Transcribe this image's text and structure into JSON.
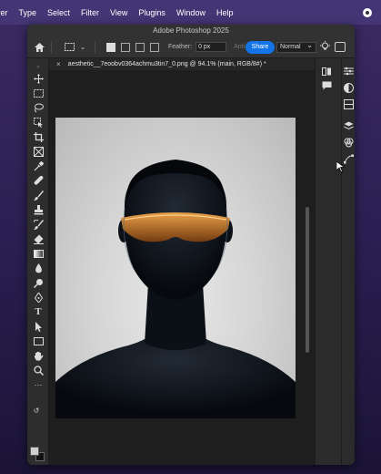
{
  "menubar": {
    "items": [
      "yer",
      "Type",
      "Select",
      "Filter",
      "View",
      "Plugins",
      "Window",
      "Help"
    ]
  },
  "window": {
    "title": "Adobe Photoshop 2025"
  },
  "options_bar": {
    "feather_label": "Feather:",
    "feather_value": "0 px",
    "antialias_label": "Anti-alias",
    "share_label": "Share",
    "style_value": "Normal"
  },
  "document_tab": {
    "label": "aesthetic__7eoobv0364achmu3tin7_0.png @ 94.1% (main, RGB/8#) *",
    "close": "×"
  },
  "colors": {
    "accent": "#1473e6",
    "glasses": "#e08a2a",
    "foreground_swatch": "#cfcfcf",
    "background_swatch": "#111111"
  },
  "tools": [
    "move-icon",
    "marquee-icon",
    "lasso-icon",
    "object-select-icon",
    "crop-icon",
    "frame-icon",
    "eyedropper-icon",
    "healing-icon",
    "brush-icon",
    "stamp-icon",
    "history-brush-icon",
    "eraser-icon",
    "gradient-icon",
    "blur-icon",
    "dodge-icon",
    "pen-icon",
    "type-icon",
    "path-select-icon",
    "rectangle-icon",
    "hand-icon",
    "zoom-icon",
    "more-tools-icon"
  ],
  "right_dock_icons": [
    "properties-icon",
    "adjustments-icon",
    "libraries-icon",
    "layers-icon",
    "channels-icon",
    "paths-icon",
    "history-icon",
    "comments-icon"
  ]
}
